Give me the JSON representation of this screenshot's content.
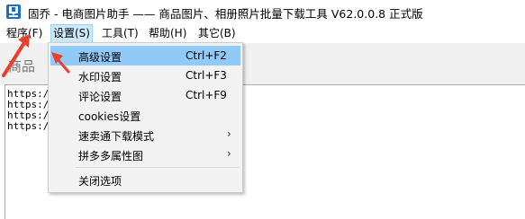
{
  "window": {
    "title": "固乔 - 电商图片助手 —— 商品图片、相册照片批量下载工具 V62.0.0.8 正式版",
    "icon": "download-app-icon"
  },
  "menubar": {
    "items": [
      {
        "label": "程序(F)"
      },
      {
        "label": "设置(S)"
      },
      {
        "label": "工具(T)"
      },
      {
        "label": "帮助(H)"
      },
      {
        "label": "其它(B)"
      }
    ]
  },
  "toolbar": {
    "label": "商品"
  },
  "textarea": {
    "lines": [
      "https:/",
      "https:/",
      "https:/",
      "https:/"
    ]
  },
  "dropdown": {
    "items": [
      {
        "label": "高级设置",
        "shortcut": "Ctrl+F2"
      },
      {
        "label": "水印设置",
        "shortcut": "Ctrl+F3"
      },
      {
        "label": "评论设置",
        "shortcut": "Ctrl+F9"
      },
      {
        "label": "cookies设置",
        "shortcut": ""
      },
      {
        "label": "速卖通下载模式",
        "shortcut": "",
        "arrow": "›"
      },
      {
        "label": "拼多多属性图",
        "shortcut": "",
        "arrow": "›"
      },
      {
        "label": "关闭选项",
        "shortcut": ""
      }
    ]
  },
  "colors": {
    "highlight": "#91c9f7",
    "annotation_arrow": "#e8402c",
    "menu_active_bg": "#cce8ff"
  }
}
